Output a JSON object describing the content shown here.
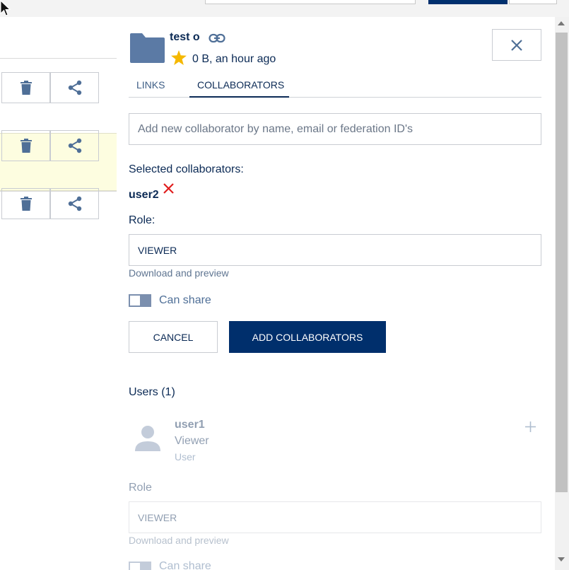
{
  "header": {
    "title": "test o",
    "meta": "0 B, an hour ago"
  },
  "tabs": [
    {
      "label": "LINKS",
      "active": false
    },
    {
      "label": "COLLABORATORS",
      "active": true
    }
  ],
  "add_collaborator": {
    "placeholder": "Add new collaborator by name, email or federation ID's",
    "selected_label": "Selected collaborators:",
    "selected": [
      "user2"
    ],
    "role_label": "Role:",
    "role_value": "VIEWER",
    "role_hint": "Download and preview",
    "can_share_label": "Can share",
    "can_share": true,
    "cancel_label": "CANCEL",
    "submit_label": "ADD COLLABORATORS"
  },
  "users_section": {
    "title": "Users (1)",
    "users": [
      {
        "name": "user1",
        "role": "Viewer",
        "type": "User",
        "role_label": "Role",
        "role_value": "VIEWER",
        "role_hint": "Download and preview",
        "can_share_label": "Can share"
      }
    ]
  },
  "colors": {
    "primary": "#002f6c",
    "text": "#0b2a55",
    "star": "#f5b800",
    "remove": "#e01e1e",
    "highlight_row": "#fdfde0"
  },
  "icons": [
    "folder-icon",
    "link-icon",
    "star-icon",
    "close-icon",
    "trash-icon",
    "share-icon",
    "remove-icon",
    "user-avatar-icon",
    "plus-icon"
  ]
}
